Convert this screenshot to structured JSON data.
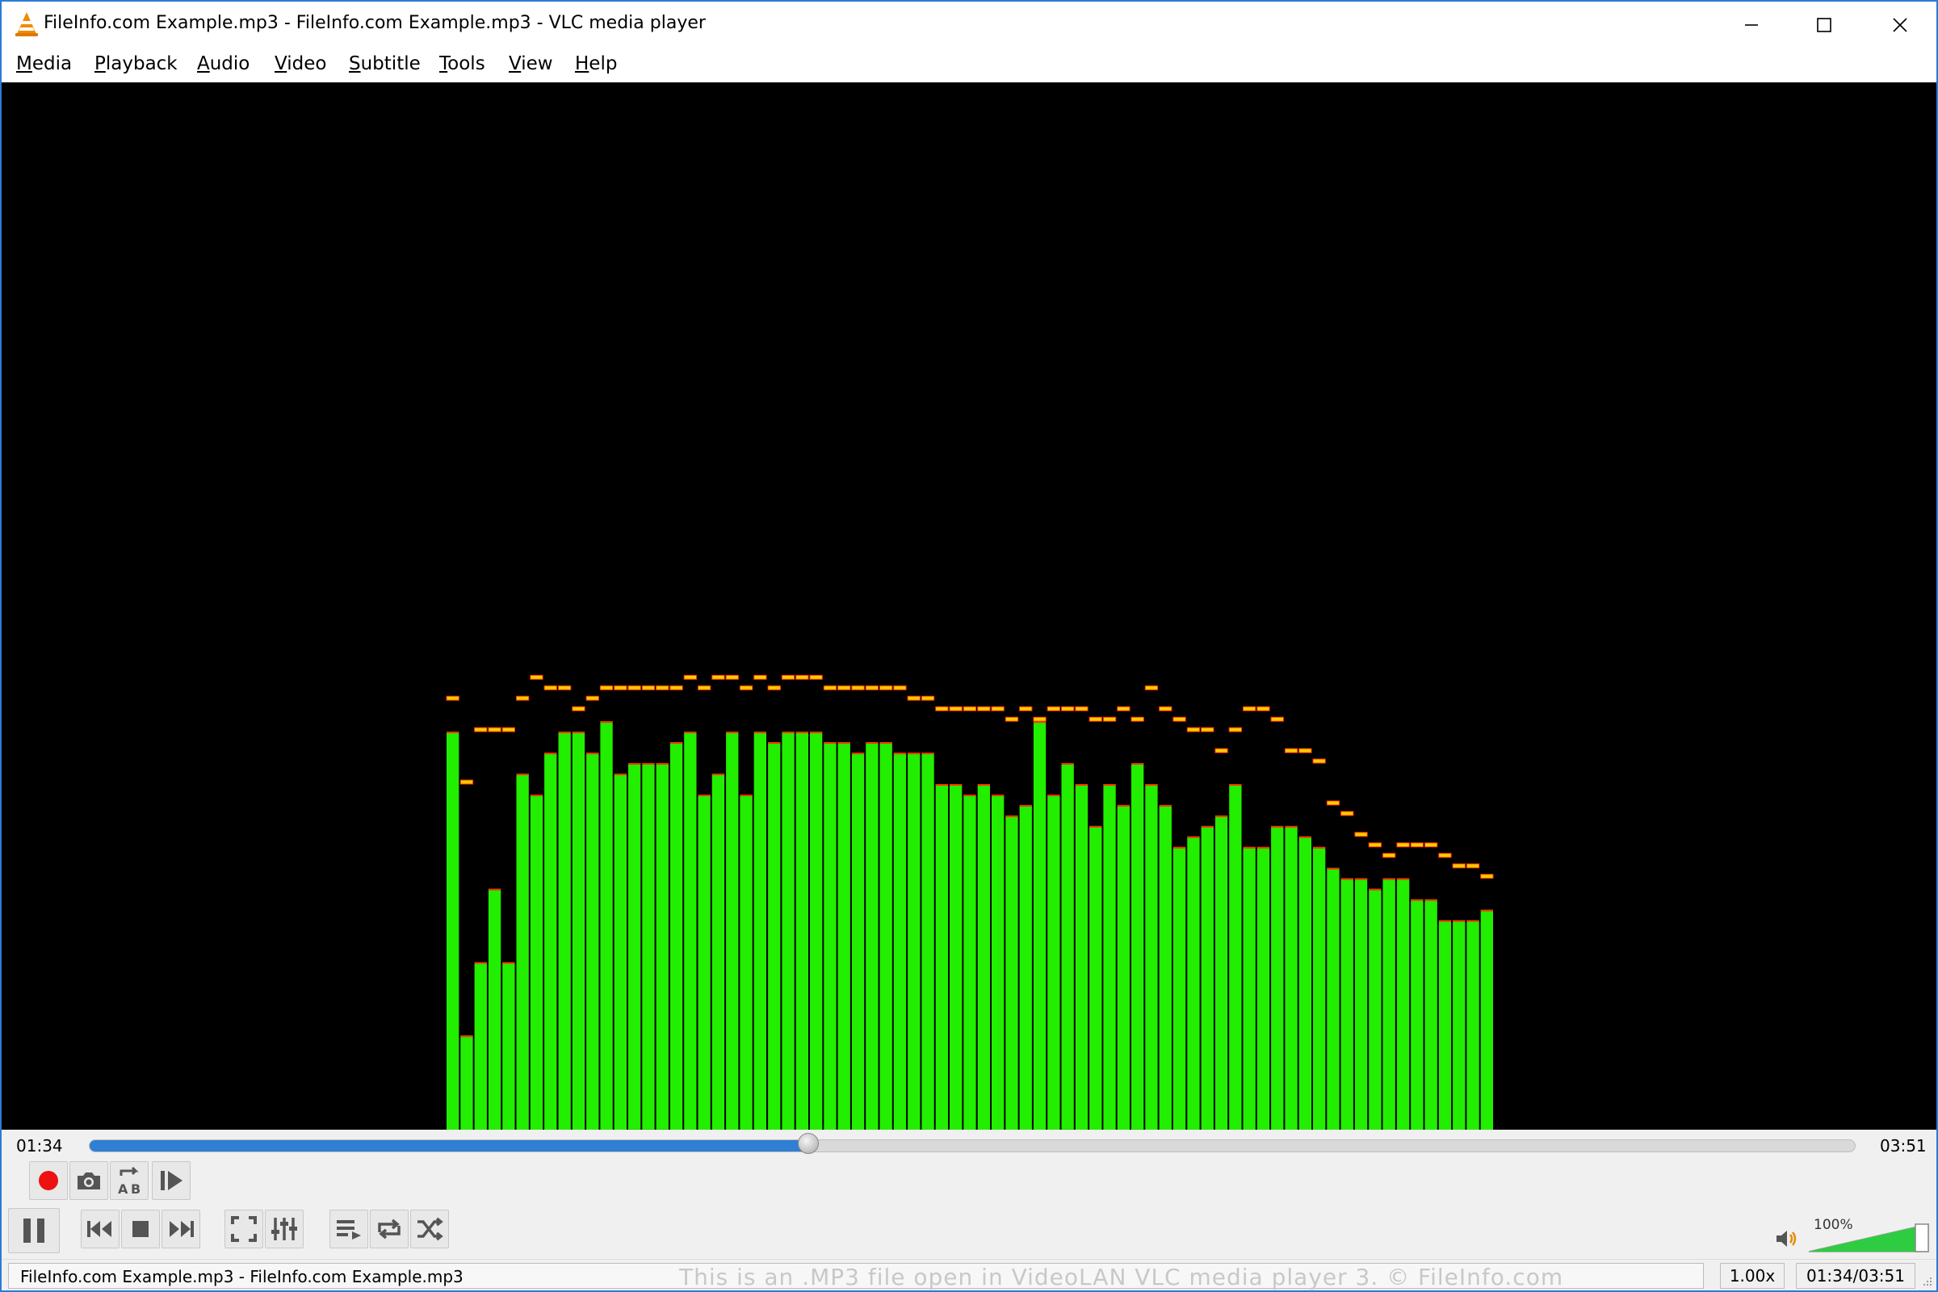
{
  "window": {
    "title": "FileInfo.com Example.mp3 - FileInfo.com Example.mp3 - VLC media player",
    "accent_color": "#2b7bd6",
    "app_icon": "vlc-cone-icon"
  },
  "menu": {
    "items": [
      "Media",
      "Playback",
      "Audio",
      "Video",
      "Subtitle",
      "Tools",
      "View",
      "Help"
    ]
  },
  "visualization": {
    "type": "spectrum",
    "bar_color_top": "#ffff00",
    "bar_color_bottom": "#22ee00",
    "peak_color": "#ff3300",
    "levels": [
      0.38,
      0.09,
      0.16,
      0.23,
      0.16,
      0.34,
      0.32,
      0.36,
      0.38,
      0.38,
      0.36,
      0.39,
      0.34,
      0.35,
      0.35,
      0.35,
      0.37,
      0.38,
      0.32,
      0.34,
      0.38,
      0.32,
      0.38,
      0.37,
      0.38,
      0.38,
      0.38,
      0.37,
      0.37,
      0.36,
      0.37,
      0.37,
      0.36,
      0.36,
      0.36,
      0.33,
      0.33,
      0.32,
      0.33,
      0.32,
      0.3,
      0.31,
      0.39,
      0.32,
      0.35,
      0.33,
      0.29,
      0.33,
      0.31,
      0.35,
      0.33,
      0.31,
      0.27,
      0.28,
      0.29,
      0.3,
      0.33,
      0.27,
      0.27,
      0.29,
      0.29,
      0.28,
      0.27,
      0.25,
      0.24,
      0.24,
      0.23,
      0.24,
      0.24,
      0.22,
      0.22,
      0.2,
      0.2,
      0.2,
      0.21
    ],
    "peaks": [
      0.41,
      0.33,
      0.38,
      0.38,
      0.38,
      0.41,
      0.43,
      0.42,
      0.42,
      0.4,
      0.41,
      0.42,
      0.42,
      0.42,
      0.42,
      0.42,
      0.42,
      0.43,
      0.42,
      0.43,
      0.43,
      0.42,
      0.43,
      0.42,
      0.43,
      0.43,
      0.43,
      0.42,
      0.42,
      0.42,
      0.42,
      0.42,
      0.42,
      0.41,
      0.41,
      0.4,
      0.4,
      0.4,
      0.4,
      0.4,
      0.39,
      0.4,
      0.39,
      0.4,
      0.4,
      0.4,
      0.39,
      0.39,
      0.4,
      0.39,
      0.42,
      0.4,
      0.39,
      0.38,
      0.38,
      0.36,
      0.38,
      0.4,
      0.4,
      0.39,
      0.36,
      0.36,
      0.35,
      0.31,
      0.3,
      0.28,
      0.27,
      0.26,
      0.27,
      0.27,
      0.27,
      0.26,
      0.25,
      0.25,
      0.24
    ]
  },
  "playback": {
    "elapsed": "01:34",
    "total": "03:51",
    "progress": 0.407,
    "progress_color": "#2f7fd3"
  },
  "controls": {
    "row1": [
      {
        "name": "record-button",
        "icon": "record-icon"
      },
      {
        "name": "snapshot-button",
        "icon": "camera-icon"
      },
      {
        "name": "ab-loop-button",
        "icon": "ab-loop-icon"
      },
      {
        "name": "frame-step-button",
        "icon": "frame-step-icon"
      }
    ],
    "row2": [
      {
        "name": "pause-button",
        "icon": "pause-icon"
      },
      {
        "name": "previous-button",
        "icon": "skip-previous-icon"
      },
      {
        "name": "stop-button",
        "icon": "stop-icon"
      },
      {
        "name": "next-button",
        "icon": "skip-next-icon"
      },
      {
        "name": "fullscreen-button",
        "icon": "fullscreen-icon"
      },
      {
        "name": "extended-settings-button",
        "icon": "equalizer-icon"
      },
      {
        "name": "playlist-button",
        "icon": "playlist-icon"
      },
      {
        "name": "loop-button",
        "icon": "repeat-icon"
      },
      {
        "name": "shuffle-button",
        "icon": "shuffle-icon"
      }
    ],
    "record_color": "#ee1111"
  },
  "volume": {
    "label": "100%",
    "level": 1.0,
    "fill_color": "#2ecc40",
    "icon": "speaker-icon"
  },
  "statusbar": {
    "file": "FileInfo.com Example.mp3 - FileInfo.com Example.mp3",
    "watermark": "This is an .MP3 file open in VideoLAN VLC media player 3. © FileInfo.com",
    "speed": "1.00x",
    "time": "01:34/03:51"
  }
}
